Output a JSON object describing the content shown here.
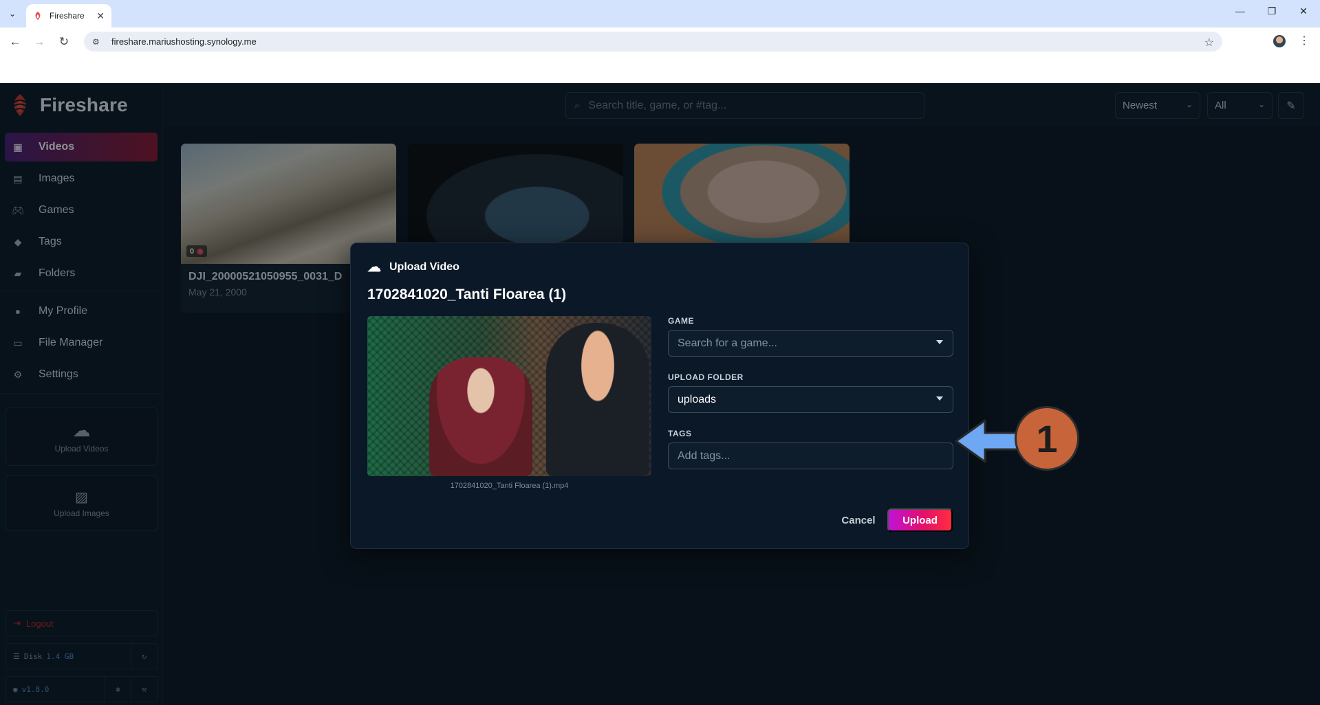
{
  "browser": {
    "tab_title": "Fireshare",
    "url": "fireshare.mariushosting.synology.me",
    "window_controls": [
      "minimize-icon",
      "restore-icon",
      "close-icon"
    ]
  },
  "app": {
    "logo_text": "Fireshare",
    "search_placeholder": "Search title, game, or #tag...",
    "sort_value": "Newest",
    "filter_value": "All",
    "nav": [
      {
        "label": "Videos",
        "icon": "video-library-icon",
        "active": true
      },
      {
        "label": "Images",
        "icon": "image-library-icon",
        "active": false
      },
      {
        "label": "Games",
        "icon": "gamepad-icon",
        "active": false
      },
      {
        "label": "Tags",
        "icon": "tag-icon",
        "active": false
      },
      {
        "label": "Folders",
        "icon": "folder-icon",
        "active": false
      }
    ],
    "nav2": [
      {
        "label": "My Profile",
        "icon": "person-icon"
      },
      {
        "label": "File Manager",
        "icon": "folder-outline-icon"
      },
      {
        "label": "Settings",
        "icon": "gear-icon"
      }
    ],
    "upload_videos_label": "Upload Videos",
    "upload_images_label": "Upload Images",
    "logout_label": "Logout",
    "disk_label": "Disk",
    "disk_value": "1.4 GB",
    "version": "v1.8.0",
    "colors": {
      "background": "#0b1622",
      "accent_gradient_start": "#c012d9",
      "accent_gradient_end": "#ff2d3f",
      "active_nav": "#6c1d4a",
      "logout": "#c62828"
    }
  },
  "cards": [
    {
      "title": "DJI_20000521050955_0031_D",
      "date": "May 21, 2000",
      "views": "0"
    },
    {
      "title": "",
      "date": "",
      "views": ""
    },
    {
      "title": "",
      "date": "",
      "views": ""
    }
  ],
  "modal": {
    "header": "Upload Video",
    "title": "1702841020_Tanti Floarea (1)",
    "filename": "1702841020_Tanti Floarea (1).mp4",
    "game_label": "GAME",
    "game_placeholder": "Search for a game...",
    "folder_label": "UPLOAD FOLDER",
    "folder_value": "uploads",
    "tags_label": "TAGS",
    "tags_placeholder": "Add tags...",
    "cancel_label": "Cancel",
    "upload_label": "Upload"
  },
  "annotation": {
    "step_number": "1",
    "arrow_color": "#6ea8f5",
    "badge_color": "#c8643a"
  }
}
